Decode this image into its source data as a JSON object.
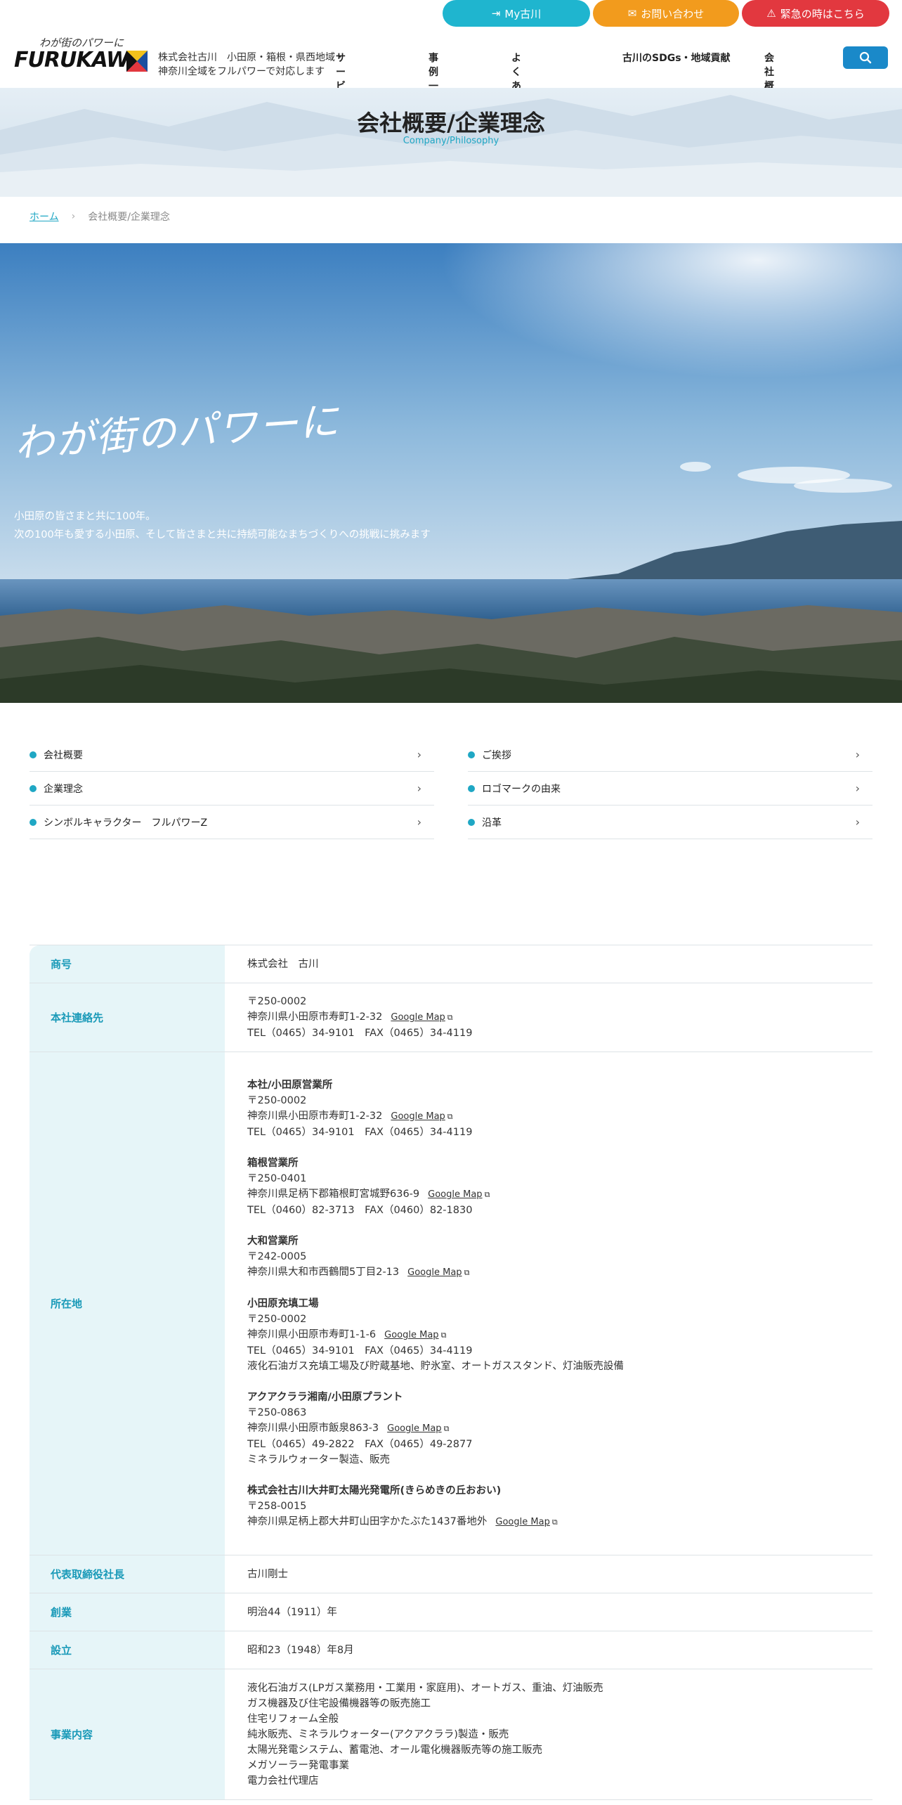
{
  "header": {
    "top_buttons": {
      "my": "My古川",
      "contact": "お問い合わせ",
      "emergency": "緊急の時はこちら"
    },
    "logo_script": "わが街のパワーに",
    "logo_word": "FURUKAWA",
    "tagline_line1": "株式会社古川　小田原・箱根・県西地域・",
    "tagline_line2": "神奈川全域をフルパワーで対応します",
    "nav": [
      "サービス一覧",
      "事例一覧",
      "よくあるご質問",
      "古川のSDGs・地域貢献",
      "会社概要"
    ]
  },
  "page": {
    "title": "会社概要/企業理念",
    "subtitle": "Company/Philosophy"
  },
  "breadcrumb": {
    "home": "ホーム",
    "current": "会社概要/企業理念"
  },
  "hero": {
    "script": "わが街のパワーに",
    "line1": "小田原の皆さまと共に100年。",
    "line2": "次の100年も愛する小田原、そして皆さまと共に持続可能なまちづくりへの挑戦に挑みます"
  },
  "anchors": [
    "会社概要",
    "ご挨拶",
    "企業理念",
    "ロゴマークの由来",
    "シンボルキャラクター　フルパワーZ",
    "沿革"
  ],
  "company": {
    "gmap_label": "Google Map",
    "rows": {
      "name_label": "商号",
      "name_value": "株式会社　古川",
      "hq_label": "本社連絡先",
      "hq_zip": "〒250-0002",
      "hq_addr": "神奈川県小田原市寿町1-2-32",
      "hq_tel": "TEL（0465）34-9101　FAX（0465）34-4119",
      "loc_label": "所在地",
      "offices": [
        {
          "name": "本社/小田原営業所",
          "zip": "〒250-0002",
          "addr": "神奈川県小田原市寿町1-2-32",
          "extra1": "TEL（0465）34-9101　FAX（0465）34-4119",
          "extra2": ""
        },
        {
          "name": "箱根営業所",
          "zip": "〒250-0401",
          "addr": "神奈川県足柄下郡箱根町宮城野636-9",
          "extra1": "TEL（0460）82-3713　FAX（0460）82-1830",
          "extra2": ""
        },
        {
          "name": "大和営業所",
          "zip": "〒242-0005",
          "addr": "神奈川県大和市西鶴間5丁目2-13",
          "extra1": "",
          "extra2": ""
        },
        {
          "name": "小田原充填工場",
          "zip": "〒250-0002",
          "addr": "神奈川県小田原市寿町1-1-6",
          "extra1": "TEL（0465）34-9101　FAX（0465）34-4119",
          "extra2": "液化石油ガス充填工場及び貯蔵基地、貯氷室、オートガススタンド、灯油販売設備"
        },
        {
          "name": "アクアクララ湘南/小田原プラント",
          "zip": "〒250-0863",
          "addr": "神奈川県小田原市飯泉863-3",
          "extra1": "TEL（0465）49-2822　FAX（0465）49-2877",
          "extra2": "ミネラルウォーター製造、販売"
        },
        {
          "name": "株式会社古川大井町太陽光発電所(きらめきの丘おおい)",
          "zip": "〒258-0015",
          "addr": "神奈川県足柄上郡大井町山田字かたぶた1437番地外",
          "extra1": "",
          "extra2": ""
        }
      ],
      "ceo_label": "代表取締役社長",
      "ceo_value": "古川剛士",
      "founded_label": "創業",
      "founded_value": "明治44（1911）年",
      "est_label": "設立",
      "est_value": "昭和23（1948）年8月",
      "biz_label": "事業内容",
      "biz": [
        "液化石油ガス(LPガス業務用・工業用・家庭用)、オートガス、重油、灯油販売",
        "ガス機器及び住宅設備機器等の販売施工",
        "住宅リフォーム全般",
        "純氷販売、ミネラルウォーター(アクアクララ)製造・販売",
        "太陽光発電システム、蓄電池、オール電化機器販売等の施工販売",
        "メガソーラー発電事業",
        "電力会社代理店"
      ]
    }
  }
}
